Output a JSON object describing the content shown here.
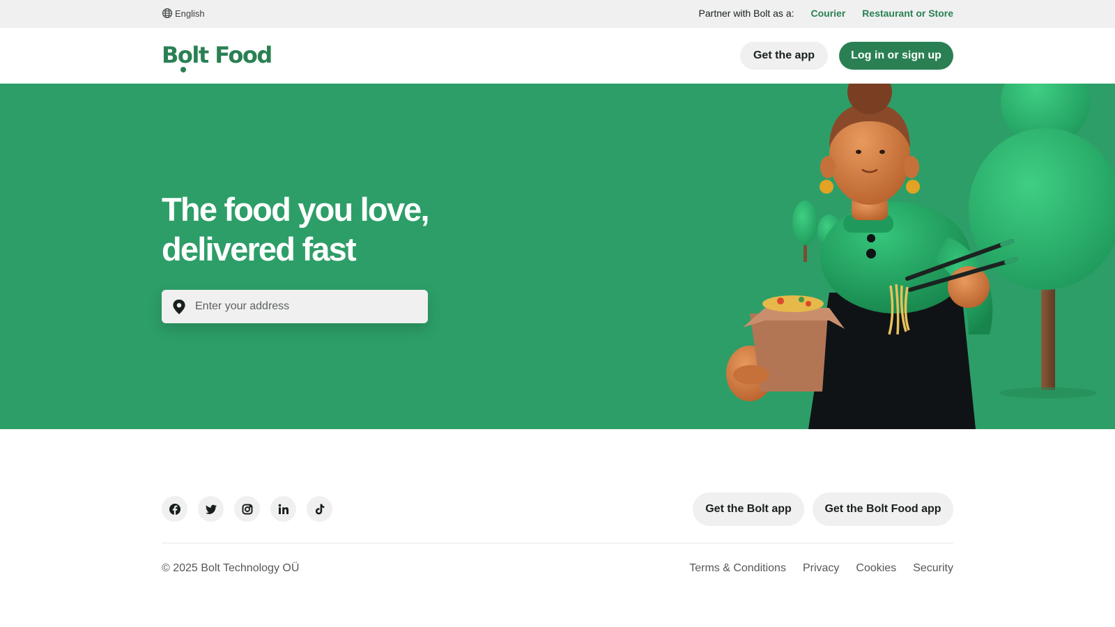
{
  "topbar": {
    "language": "English",
    "language_icon": "globe-icon",
    "partner_label": "Partner with Bolt as a:",
    "partner_links": [
      "Courier",
      "Restaurant or Store"
    ]
  },
  "header": {
    "logo_text": "Bolt Food",
    "get_app_label": "Get the app",
    "login_label": "Log in or sign up"
  },
  "hero": {
    "title_line1": "The food you love,",
    "title_line2": "delivered fast",
    "address_placeholder": "Enter your address",
    "address_value": "",
    "address_icon": "location-pin-icon",
    "illustration": "3d-woman-holding-noodle-box-illustration"
  },
  "footer": {
    "social_icons": [
      "facebook-icon",
      "twitter-icon",
      "instagram-icon",
      "linkedin-icon",
      "tiktok-icon"
    ],
    "get_bolt_app_label": "Get the Bolt app",
    "get_bolt_food_app_label": "Get the Bolt Food app",
    "copyright": "© 2025 Bolt Technology OÜ",
    "legal_links": [
      "Terms & Conditions",
      "Privacy",
      "Cookies",
      "Security"
    ]
  },
  "colors": {
    "brand_green": "#2a8053",
    "hero_green": "#2d9e68",
    "topbar_bg": "#eff0ef",
    "pill_bg": "#eff0ef",
    "text_dark": "#191f1c",
    "text_muted": "#545856"
  }
}
